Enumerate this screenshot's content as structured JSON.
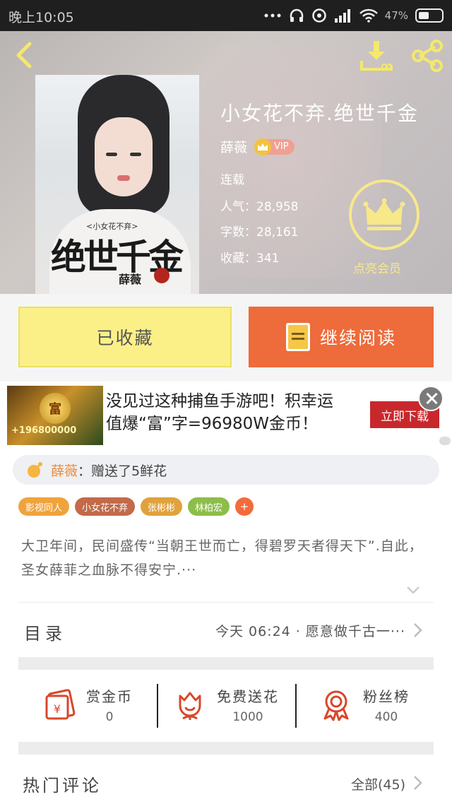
{
  "status_bar": {
    "time": "晚上10:05",
    "battery": "47%"
  },
  "book": {
    "title": "小女花不弃.绝世千金",
    "author": "薛薇",
    "vip_label": "VIP",
    "serial_status": "连载",
    "popularity_label": "人气：",
    "popularity_value": "28,958",
    "word_count_label": "字数：",
    "word_count_value": "28,161",
    "favorites_label": "收藏：",
    "favorites_value": "341",
    "cover": {
      "subtitle": "<小女花不弃>",
      "big_title": "绝世千金",
      "author": "薛薇"
    }
  },
  "member": {
    "label": "点亮会员"
  },
  "actions": {
    "collect_label": "已收藏",
    "read_label": "继续阅读"
  },
  "ad": {
    "amount": "+196800000",
    "coin_char": "富",
    "line1": "没见过这种捕鱼手游吧！积幸运",
    "line2": "值爆“富”字=96980W金币！",
    "button_label": "立即下载"
  },
  "gift": {
    "giver": "薛薇",
    "action": "：赠送了5鲜花"
  },
  "tags": [
    {
      "label": "影视同人",
      "color": "#f0a33c"
    },
    {
      "label": "小女花不弃",
      "color": "#c26a4a"
    },
    {
      "label": "张彬彬",
      "color": "#e0a23c"
    },
    {
      "label": "林柏宏",
      "color": "#8dbd4a"
    }
  ],
  "tag_add": "+",
  "description": "大卫年间，民间盛传“当朝王世而亡，得碧罗天者得天下”.自此，圣女薛菲之血脉不得安宁.···",
  "catalog": {
    "label": "目录",
    "latest": "今天 06:24 · 愿意做千古一···"
  },
  "stats": [
    {
      "name": "赏金币",
      "value": "0",
      "icon": "red-envelope-icon"
    },
    {
      "name": "免费送花",
      "value": "1000",
      "icon": "flower-icon"
    },
    {
      "name": "粉丝榜",
      "value": "400",
      "icon": "medal-icon"
    }
  ],
  "hot_comments": {
    "label": "热门评论",
    "all_label": "全部(45)"
  },
  "colors": {
    "accent_orange": "#ee6b3b",
    "collect_yellow": "#fbf088",
    "member_gold": "#f7e88a",
    "icon_red": "#d9462a"
  }
}
